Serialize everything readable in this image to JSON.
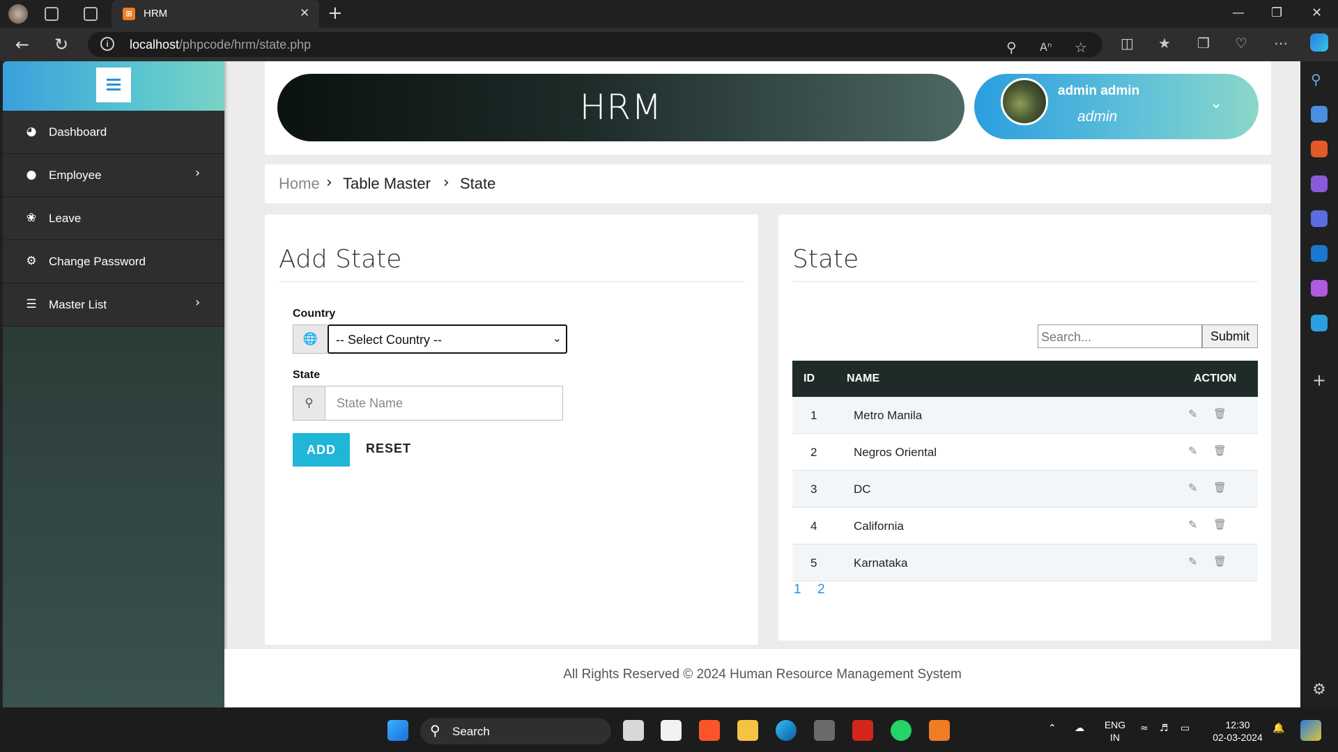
{
  "browser": {
    "tab_title": "HRM",
    "tab_favicon": "XAMPP",
    "url_host": "localhost",
    "url_path": "/phpcode/hrm/state.php"
  },
  "colors": {
    "accent": "#1fb6d8",
    "sidebar_top": "#3aa0dc",
    "table_header": "#1f2b29",
    "link": "#2a8fd3"
  },
  "sidebar": {
    "items": [
      {
        "label": "Dashboard",
        "icon": "dashboard-icon",
        "has_submenu": false
      },
      {
        "label": "Employee",
        "icon": "user-icon",
        "has_submenu": true
      },
      {
        "label": "Leave",
        "icon": "leave-icon",
        "has_submenu": false
      },
      {
        "label": "Change Password",
        "icon": "gears-icon",
        "has_submenu": false
      },
      {
        "label": "Master List",
        "icon": "list-icon",
        "has_submenu": true
      }
    ]
  },
  "header": {
    "app_title": "HRM",
    "user_name": "admin admin",
    "user_role": "admin"
  },
  "breadcrumb": [
    "Home",
    "Table Master",
    "State"
  ],
  "add_form": {
    "title": "Add State",
    "country_label": "Country",
    "country_value": "-- Select Country --",
    "state_label": "State",
    "state_placeholder": "State Name",
    "add_label": "ADD",
    "reset_label": "RESET"
  },
  "state_list": {
    "title": "State",
    "search_placeholder": "Search...",
    "submit_label": "Submit",
    "columns": [
      "ID",
      "NAME",
      "ACTION"
    ],
    "rows": [
      {
        "id": "1",
        "name": "Metro Manila"
      },
      {
        "id": "2",
        "name": "Negros Oriental"
      },
      {
        "id": "3",
        "name": "DC"
      },
      {
        "id": "4",
        "name": "California"
      },
      {
        "id": "5",
        "name": "Karnataka"
      }
    ],
    "pages": [
      "1",
      "2"
    ]
  },
  "footer": {
    "text": "All Rights Reserved © 2024 Human Resource Management System"
  },
  "taskbar": {
    "search_label": "Search",
    "lang_top": "ENG",
    "lang_bottom": "IN",
    "time": "12:30",
    "date": "02-03-2024"
  }
}
